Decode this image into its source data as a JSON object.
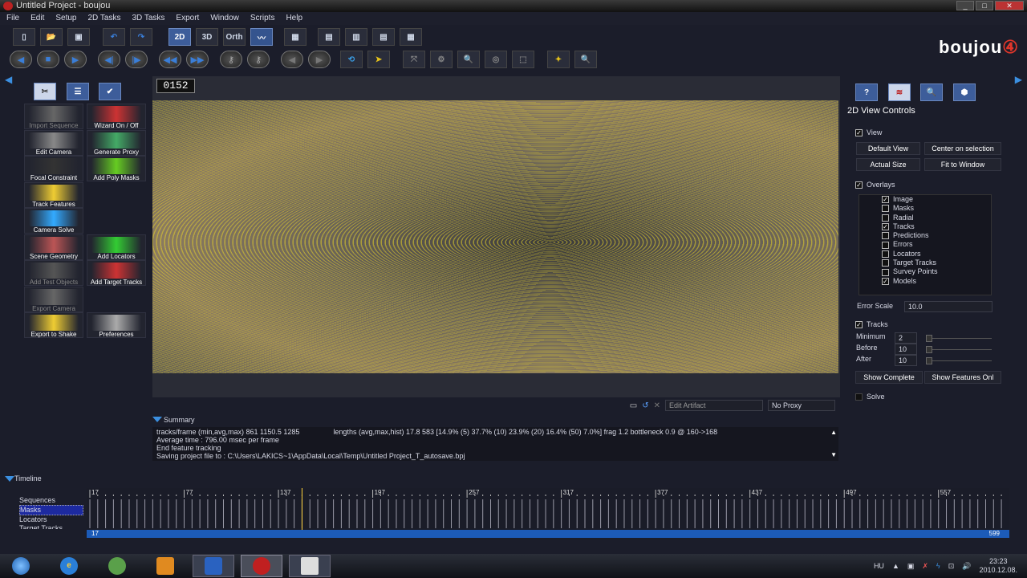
{
  "window": {
    "title": "Untitled Project - boujou"
  },
  "menu": [
    "File",
    "Edit",
    "Setup",
    "2D Tasks",
    "3D Tasks",
    "Export",
    "Window",
    "Scripts",
    "Help"
  ],
  "toolbar": {
    "view_2d": "2D",
    "view_3d": "3D",
    "view_orth": "Orth"
  },
  "brand": {
    "name": "boujou",
    "version": "4"
  },
  "left_panel": {
    "tools": [
      {
        "label": "Import Sequence",
        "enabled": false
      },
      {
        "label": "Wizard On / Off",
        "enabled": true
      },
      {
        "label": "Edit Camera",
        "enabled": true
      },
      {
        "label": "Generate Proxy",
        "enabled": true
      },
      {
        "label": "Focal Constraint",
        "enabled": true
      },
      {
        "label": "Add Poly Masks",
        "enabled": true
      },
      {
        "label": "Track Features",
        "enabled": true
      },
      {
        "label": "",
        "enabled": false
      },
      {
        "label": "Camera Solve",
        "enabled": true
      },
      {
        "label": "",
        "enabled": false
      },
      {
        "label": "Scene Geometry",
        "enabled": true
      },
      {
        "label": "Add Locators",
        "enabled": true
      },
      {
        "label": "Add Test Objects",
        "enabled": false
      },
      {
        "label": "Add Target Tracks",
        "enabled": true
      },
      {
        "label": "Export Camera",
        "enabled": false
      },
      {
        "label": "",
        "enabled": false
      },
      {
        "label": "Export to Shake",
        "enabled": true
      },
      {
        "label": "Preferences",
        "enabled": true
      }
    ]
  },
  "viewport": {
    "frame": "0152"
  },
  "status": {
    "edit_artifact": "Edit Artifact",
    "proxy": "No Proxy"
  },
  "summary": {
    "title": "Summary",
    "lines": [
      "tracks/frame (min,avg,max) 861 1150.5 1285",
      "lengths (avg,max,hist) 17.8 583 [14.9% (5) 37.7% (10) 23.9% (20) 16.4% (50) 7.0%] frag 1.2 bottleneck 0.9 @ 160->168",
      "Average time : 796.00 msec per frame",
      "End feature tracking",
      "Saving project file to : C:\\Users\\LAKICS~1\\AppData\\Local\\Temp\\Untitled Project_T_autosave.bpj"
    ]
  },
  "timeline": {
    "title": "Timeline",
    "tracks": [
      "Sequences",
      "Masks",
      "Locators",
      "Target Tracks"
    ],
    "selected_track": "Masks",
    "tick_labels": [
      "17",
      "77",
      "137",
      "197",
      "257",
      "317",
      "377",
      "437",
      "497",
      "557"
    ],
    "start": "17",
    "end": "599",
    "current_frame": 152
  },
  "right_panel": {
    "title": "2D View Controls",
    "view": {
      "label": "View",
      "checked": true,
      "buttons": [
        "Default View",
        "Center on selection",
        "Actual Size",
        "Fit to Window"
      ]
    },
    "overlays": {
      "label": "Overlays",
      "checked": true,
      "items": [
        {
          "label": "Image",
          "checked": true
        },
        {
          "label": "Masks",
          "checked": false
        },
        {
          "label": "Radial",
          "checked": false
        },
        {
          "label": "Tracks",
          "checked": true
        },
        {
          "label": "Predictions",
          "checked": false
        },
        {
          "label": "Errors",
          "checked": false
        },
        {
          "label": "Locators",
          "checked": false
        },
        {
          "label": "Target Tracks",
          "checked": false
        },
        {
          "label": "Survey Points",
          "checked": false
        },
        {
          "label": "Models",
          "checked": true
        }
      ]
    },
    "error_scale": {
      "label": "Error Scale",
      "value": "10.0"
    },
    "tracks": {
      "label": "Tracks",
      "checked": true,
      "minimum_label": "Minimum",
      "minimum": "2",
      "before_label": "Before",
      "before": "10",
      "after_label": "After",
      "after": "10",
      "buttons": [
        "Show Complete",
        "Show Features Onl"
      ]
    },
    "solve": {
      "label": "Solve",
      "checked": false
    }
  },
  "taskbar": {
    "language": "HU",
    "time": "23:23",
    "date": "2010.12.08."
  }
}
